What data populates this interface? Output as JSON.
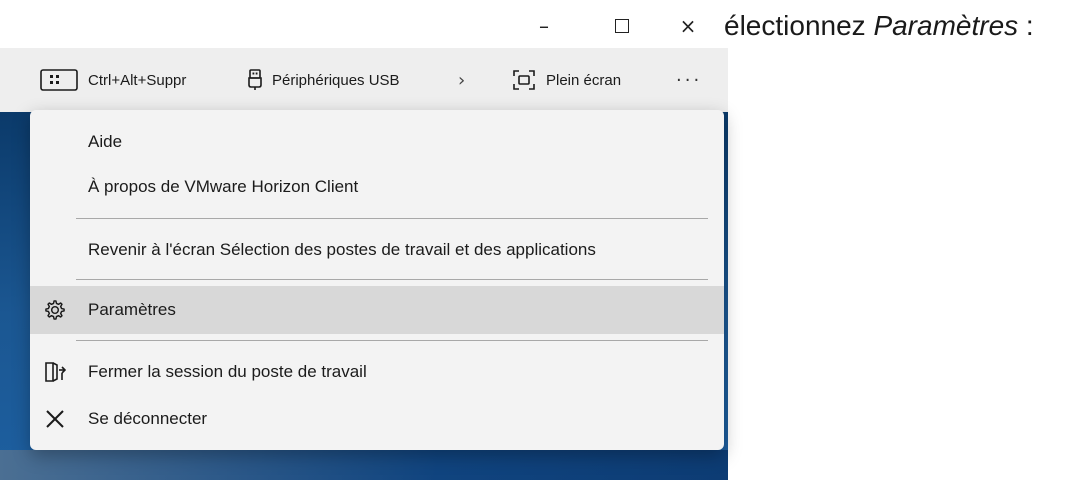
{
  "window": {
    "minimize_glyph": "–",
    "close_glyph": "×"
  },
  "instruction": {
    "prefix": "électionnez ",
    "emphasis": "Paramètres",
    "suffix": " :"
  },
  "toolbar": {
    "cad_label": "Ctrl+Alt+Suppr",
    "usb_label": "Périphériques USB",
    "chevron": "›",
    "fullscreen_label": "Plein écran",
    "more": "···"
  },
  "menu": {
    "help": "Aide",
    "about": "À propos de VMware Horizon Client",
    "back": "Revenir à l'écran Sélection des postes de travail et des applications",
    "settings": "Paramètres",
    "logoff": "Fermer la session du poste de travail",
    "disconnect": "Se déconnecter",
    "highlighted": "Paramètres"
  },
  "icons": {
    "cad": "keyboard-icon",
    "usb": "usb-icon",
    "fullscreen": "fullscreen-icon",
    "more": "more-icon",
    "settings": "gear-icon",
    "logoff": "logoff-icon",
    "disconnect": "close-icon"
  },
  "colors": {
    "toolbar_bg": "#eeeeee",
    "menu_bg": "#f3f3f3",
    "highlight_bg": "#d8d8d8",
    "desktop_blue": "#1b5792"
  }
}
